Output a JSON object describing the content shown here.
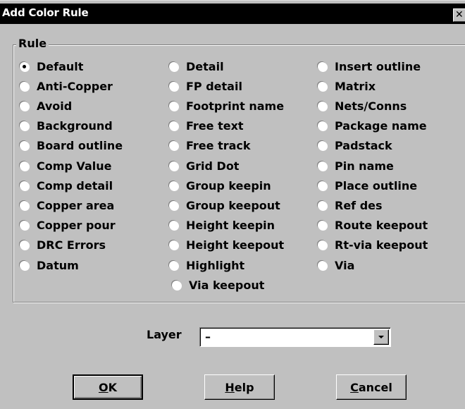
{
  "window": {
    "title": "Add Color Rule",
    "close_glyph": "✕"
  },
  "rule_group": {
    "legend": "Rule",
    "selected": "Default",
    "columns": [
      [
        "Default",
        "Anti-Copper",
        "Avoid",
        "Background",
        "Board outline",
        "Comp Value",
        "Comp detail",
        "Copper area",
        "Copper pour",
        "DRC Errors",
        "Datum"
      ],
      [
        "Detail",
        "FP detail",
        "Footprint name",
        "Free text",
        "Free track",
        "Grid Dot",
        "Group keepin",
        "Group keepout",
        "Height keepin",
        "Height keepout",
        "Highlight",
        "Via keepout"
      ],
      [
        "Insert outline",
        "Matrix",
        "Nets/Conns",
        "Package name",
        "Padstack",
        "Pin name",
        "Place outline",
        "Ref des",
        "Route keepout",
        "Rt-via keepout",
        "Via"
      ]
    ]
  },
  "layer": {
    "label": "Layer",
    "value": "–"
  },
  "buttons": {
    "ok": {
      "mnemonic": "O",
      "rest": "K"
    },
    "help": {
      "mnemonic": "H",
      "rest": "elp"
    },
    "cancel": {
      "mnemonic": "C",
      "rest": "ancel"
    }
  }
}
